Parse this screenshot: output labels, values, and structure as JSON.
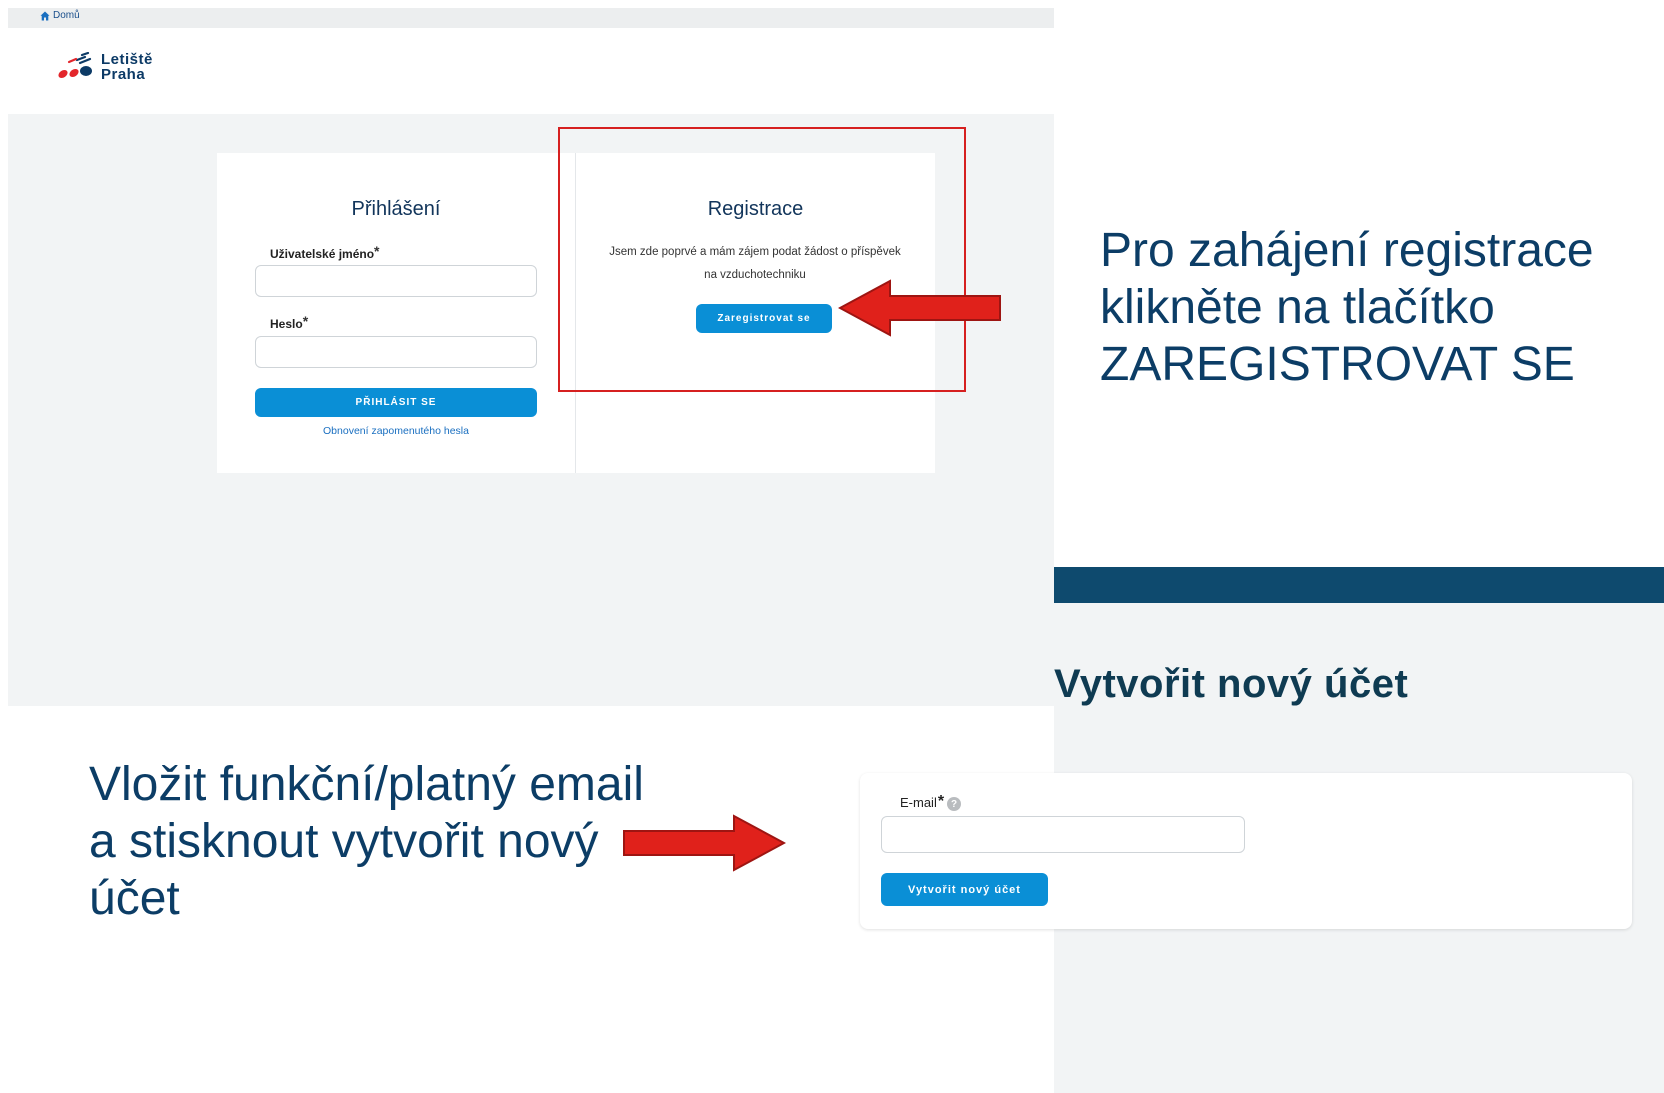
{
  "top_screenshot": {
    "breadcrumb": {
      "home_label": "Domů"
    },
    "logo": {
      "line1": "Letiště",
      "line2": "Praha"
    },
    "login": {
      "title": "Přihlášení",
      "username_label": "Uživatelské jméno",
      "password_label": "Heslo",
      "required_mark": "*",
      "username_value": "",
      "password_value": "",
      "submit_label": "PŘIHLÁSIT SE",
      "forgot_link": "Obnovení zapomenutého hesla"
    },
    "registration": {
      "title": "Registrace",
      "description": "Jsem zde poprvé a mám zájem podat žádost o příspěvek na vzduchotechniku",
      "button_label": "Zaregistrovat se"
    },
    "highlight_color": "#d62020"
  },
  "annotations": {
    "register_note": "Pro zahájení registrace klikněte na tlačítko ZAREGISTROVAT SE",
    "email_note": "Vložit  funkční/platný email a stisknout vytvořit nový účet",
    "arrow_color": "#e0211b"
  },
  "bottom_screenshot": {
    "page_title": "Vytvořit nový účet",
    "email_label": "E-mail",
    "required_mark": "*",
    "help_icon": "?",
    "email_value": "",
    "create_button_label": "Vytvořit nový účet",
    "header_bar_color": "#0e4a6e"
  },
  "colors": {
    "primary_button": "#0a8fd6",
    "note_text": "#0c3d66"
  }
}
